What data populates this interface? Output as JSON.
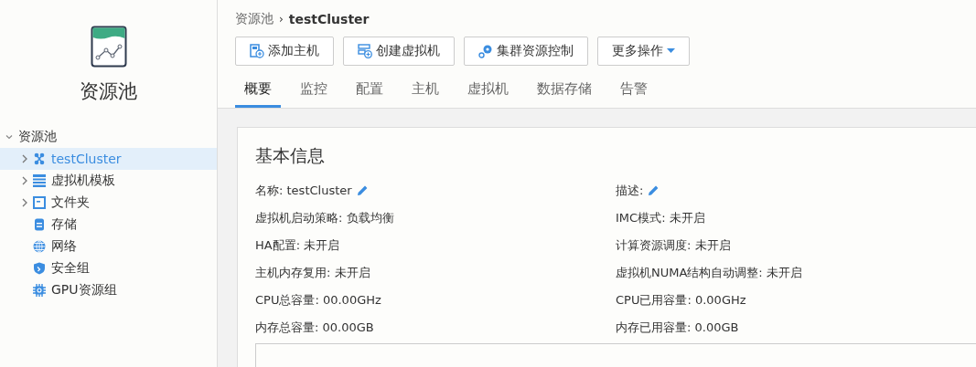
{
  "sidebar": {
    "title": "资源池",
    "tree": {
      "label": "资源池",
      "expanded": true,
      "children": [
        {
          "label": "testCluster",
          "kind": "cluster",
          "selected": true,
          "expandable": true
        },
        {
          "label": "虚拟机模板",
          "kind": "template",
          "selected": false,
          "expandable": true
        },
        {
          "label": "文件夹",
          "kind": "folder",
          "selected": false,
          "expandable": true
        },
        {
          "label": "存储",
          "kind": "storage",
          "selected": false,
          "expandable": false
        },
        {
          "label": "网络",
          "kind": "network",
          "selected": false,
          "expandable": false
        },
        {
          "label": "安全组",
          "kind": "shield",
          "selected": false,
          "expandable": false
        },
        {
          "label": "GPU资源组",
          "kind": "gpu",
          "selected": false,
          "expandable": false
        }
      ]
    }
  },
  "breadcrumb": {
    "parent": "资源池",
    "separator": "›",
    "current": "testCluster"
  },
  "toolbar": [
    {
      "label": "添加主机",
      "kind": "add-host",
      "dropdown": false
    },
    {
      "label": "创建虚拟机",
      "kind": "add-vm",
      "dropdown": false
    },
    {
      "label": "集群资源控制",
      "kind": "gears",
      "dropdown": false
    },
    {
      "label": "更多操作",
      "kind": "menu",
      "dropdown": true
    }
  ],
  "tabs": [
    {
      "label": "概要",
      "selected": true
    },
    {
      "label": "监控",
      "selected": false
    },
    {
      "label": "配置",
      "selected": false
    },
    {
      "label": "主机",
      "selected": false
    },
    {
      "label": "虚拟机",
      "selected": false
    },
    {
      "label": "数据存储",
      "selected": false
    },
    {
      "label": "告警",
      "selected": false
    }
  ],
  "basic_info": {
    "title": "基本信息",
    "left": [
      {
        "text": "名称: testCluster",
        "editable": true
      },
      {
        "text": "虚拟机启动策略: 负载均衡",
        "editable": false
      },
      {
        "text": "HA配置: 未开启",
        "editable": false
      },
      {
        "text": "主机内存复用: 未开启",
        "editable": false
      },
      {
        "text": "CPU总容量: 00.00GHz",
        "editable": false
      },
      {
        "text": "内存总容量: 00.00GB",
        "editable": false
      }
    ],
    "right": [
      {
        "text": "描述:",
        "editable": true
      },
      {
        "text": "IMC模式: 未开启",
        "editable": false
      },
      {
        "text": "计算资源调度: 未开启",
        "editable": false
      },
      {
        "text": "虚拟机NUMA结构自动调整: 未开启",
        "editable": false
      },
      {
        "text": "CPU已用容量: 0.00GHz",
        "editable": false
      },
      {
        "text": "内存已用容量: 0.00GB",
        "editable": false
      }
    ]
  }
}
